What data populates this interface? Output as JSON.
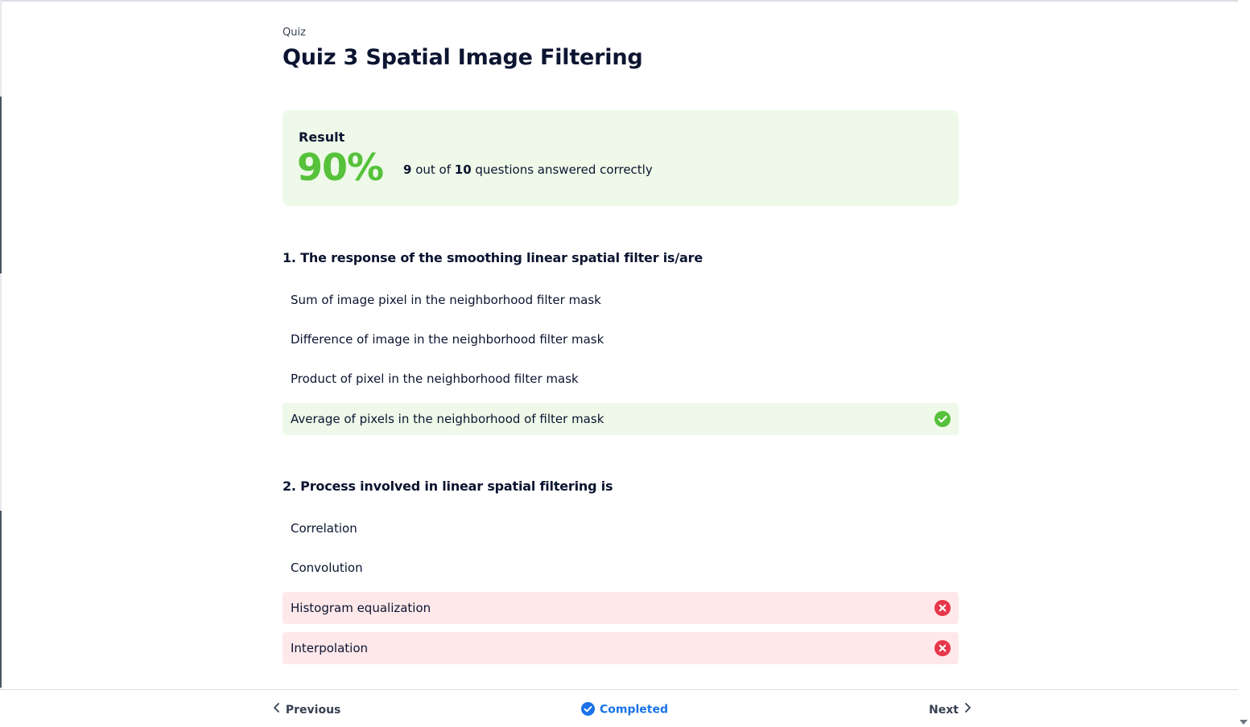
{
  "breadcrumb": "Quiz",
  "page_title": "Quiz 3 Spatial Image Filtering",
  "result": {
    "label": "Result",
    "percent": "90%",
    "correct_count": "9",
    "summary_mid": " out of ",
    "total_count": "10",
    "summary_end": " questions answered correctly",
    "accent_color": "#56c13a"
  },
  "questions": [
    {
      "title": "1. The response of the smoothing linear spatial filter is/are",
      "options": [
        {
          "text": "Sum of image pixel in the neighborhood filter mask",
          "state": "none"
        },
        {
          "text": "Difference of image in the neighborhood filter mask",
          "state": "none"
        },
        {
          "text": "Product of pixel in the neighborhood filter mask",
          "state": "none"
        },
        {
          "text": "Average of pixels in the neighborhood of filter mask",
          "state": "correct"
        }
      ]
    },
    {
      "title": "2. Process involved in linear spatial filtering is",
      "options": [
        {
          "text": "Correlation",
          "state": "none"
        },
        {
          "text": "Convolution",
          "state": "none"
        },
        {
          "text": "Histogram equalization",
          "state": "incorrect"
        },
        {
          "text": "Interpolation",
          "state": "incorrect"
        }
      ]
    }
  ],
  "footer": {
    "previous_label": "Previous",
    "completed_label": "Completed",
    "next_label": "Next"
  },
  "colors": {
    "correct_bg": "#eef9e9",
    "incorrect_bg": "#ffe8ea",
    "correct_icon": "#56c13a",
    "incorrect_icon": "#e8364a",
    "link_blue": "#1a73e8"
  },
  "icons": {
    "correct": "check-circle-icon",
    "incorrect": "x-circle-icon",
    "previous": "chevron-left-icon",
    "next": "chevron-right-icon",
    "completed": "check-circle-icon"
  }
}
